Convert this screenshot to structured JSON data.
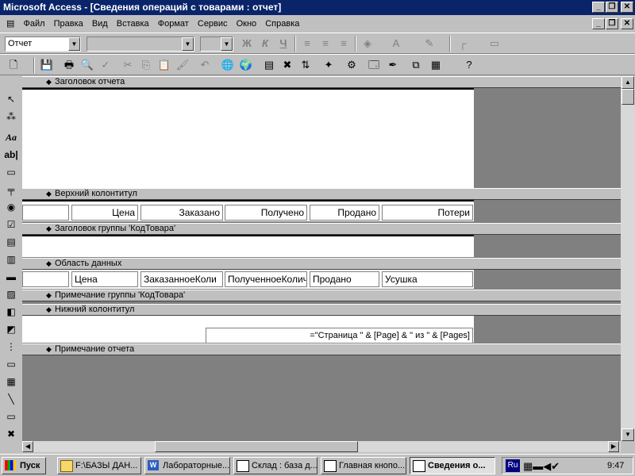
{
  "window": {
    "title": "Microsoft Access - [Сведения операций с товарами : отчет]"
  },
  "menu": [
    "Файл",
    "Правка",
    "Вид",
    "Вставка",
    "Формат",
    "Сервис",
    "Окно",
    "Справка"
  ],
  "format_toolbar": {
    "object_combo": "Отчет",
    "bold": "Ж",
    "italic": "К",
    "underline": "Ч"
  },
  "sections": {
    "report_header": "Заголовок отчета",
    "page_header": "Верхний колонтитул",
    "group_header": "Заголовок группы 'КодТовара'",
    "detail": "Область данных",
    "group_footer": "Примечание группы 'КодТовара'",
    "page_footer": "Нижний колонтитул",
    "report_footer": "Примечание отчета"
  },
  "page_header_labels": [
    "",
    "Цена",
    "Заказано",
    "Получено",
    "Продано",
    "Потери"
  ],
  "detail_fields": [
    "",
    "Цена",
    "ЗаказанноеКоли",
    "ПолученноеКоличе",
    "Продано",
    "Усушка"
  ],
  "page_footer_expr": "=\"Страница \" & [Page] & \" из \" & [Pages]",
  "toolbox": {
    "label_tool": "Aa",
    "textbox_tool": "ab|"
  },
  "taskbar": {
    "start": "Пуск",
    "tasks": [
      {
        "label": "F:\\БАЗЫ ДАН..."
      },
      {
        "label": "Лабораторные..."
      },
      {
        "label": "Склад : база д..."
      },
      {
        "label": "Главная кнопо..."
      },
      {
        "label": "Сведения о..."
      }
    ],
    "lang": "Ru",
    "clock": "9:47"
  }
}
